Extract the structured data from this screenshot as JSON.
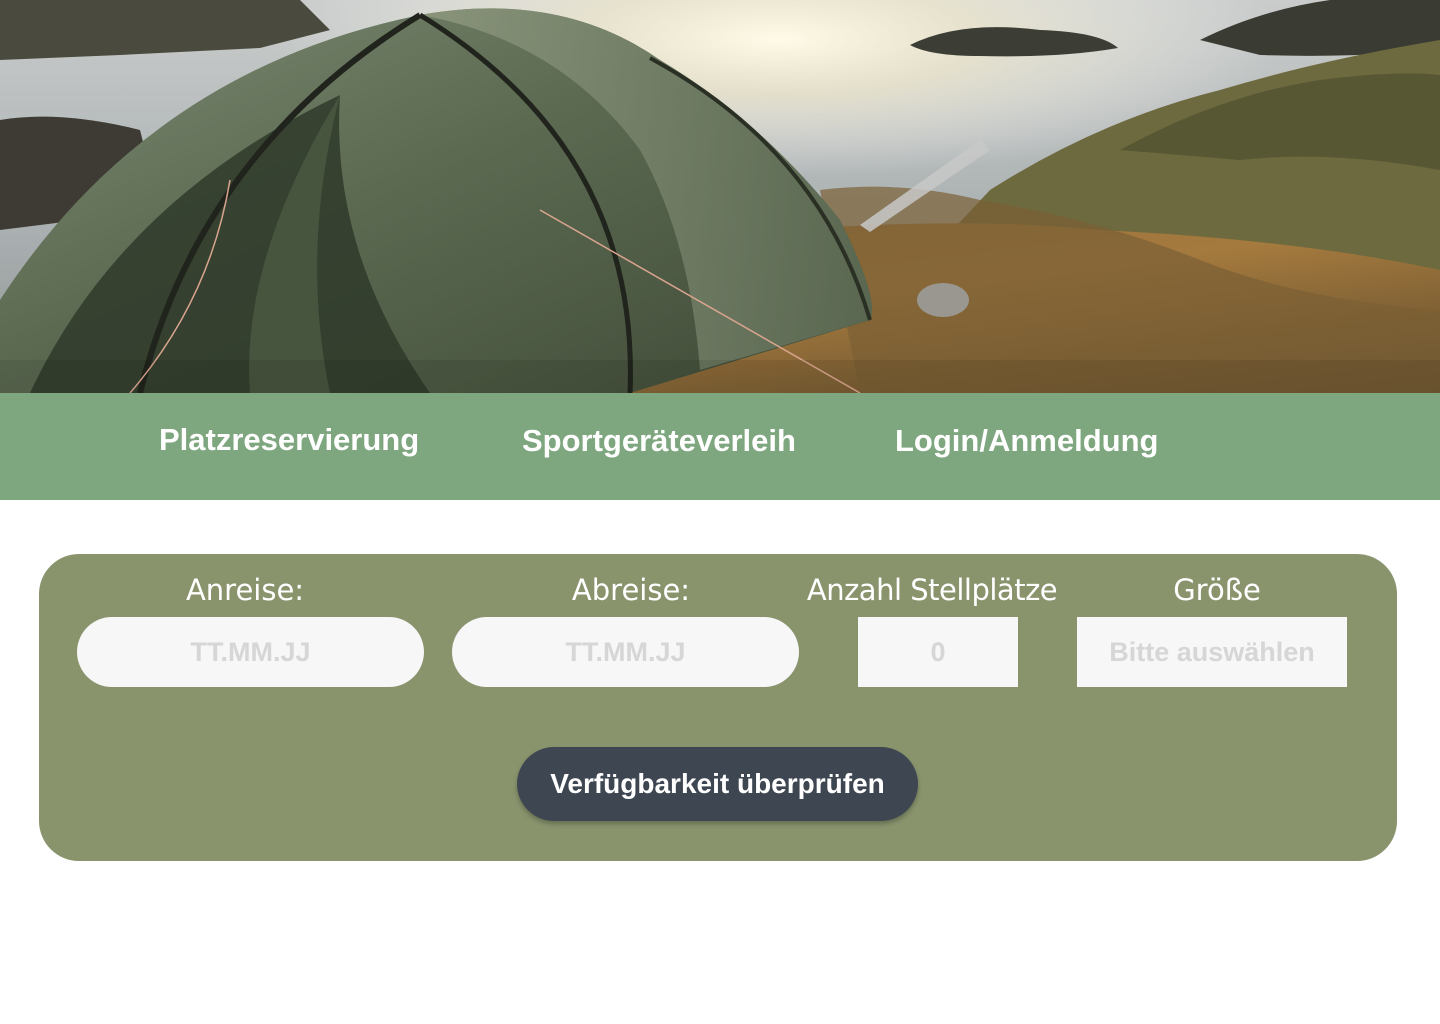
{
  "hero": {
    "image": "camping-tent-lakeside-photo"
  },
  "nav": {
    "items": [
      {
        "label": "Platzreservierung"
      },
      {
        "label": "Sportgeräteverleih"
      },
      {
        "label": "Login/Anmeldung"
      }
    ]
  },
  "booking": {
    "arrival": {
      "label": "Anreise:",
      "placeholder": "TT.MM.JJ"
    },
    "departure": {
      "label": "Abreise:",
      "placeholder": "TT.MM.JJ"
    },
    "count": {
      "label": "Anzahl Stellplätze",
      "placeholder": "0"
    },
    "size": {
      "label": "Größe",
      "placeholder": "Bitte auswählen"
    },
    "submit_label": "Verfügbarkeit überprüfen"
  },
  "colors": {
    "nav_bg": "#7ea67f",
    "panel_bg": "#89946d",
    "button_bg": "#3e4651",
    "input_bg": "#f7f7f7",
    "placeholder": "#d6d6d6"
  }
}
